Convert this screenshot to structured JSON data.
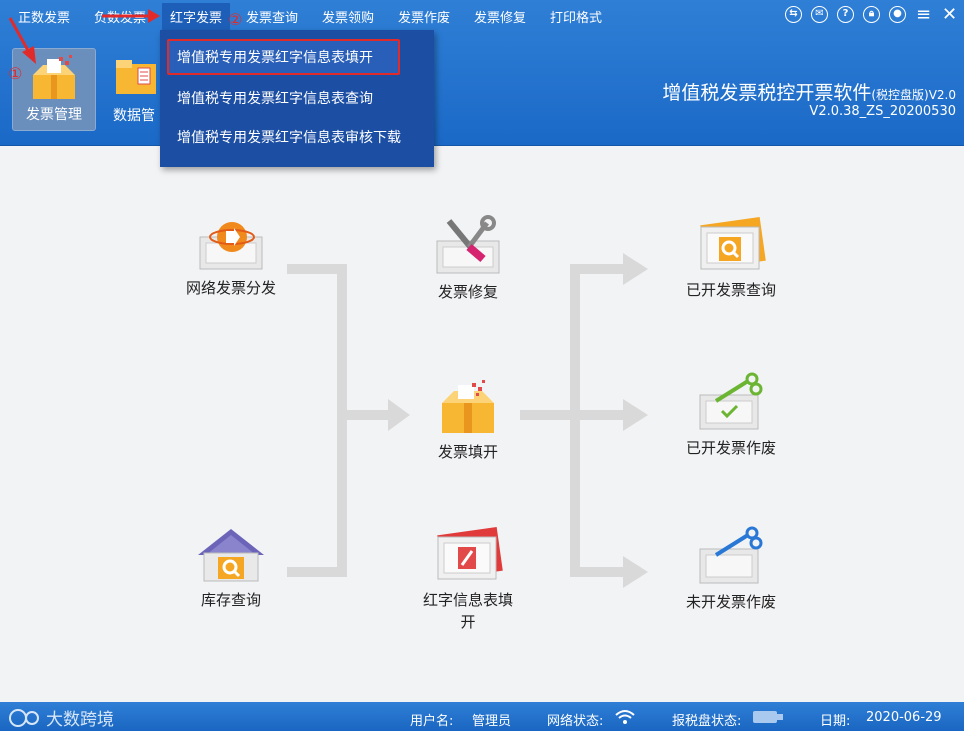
{
  "menu": {
    "items": [
      "正数发票",
      "负数发票",
      "红字发票",
      "发票查询",
      "发票领购",
      "发票作废",
      "发票修复",
      "打印格式"
    ],
    "active": "红字发票"
  },
  "window_controls": [
    "swap-icon",
    "chat-icon",
    "help-icon",
    "lock-icon",
    "user-icon",
    "menu-icon",
    "close-icon"
  ],
  "toolbar": {
    "invoice_manage": "发票管理",
    "data_manage": "数据管"
  },
  "app": {
    "title": "增值税发票税控开票软件",
    "edition": "(税控盘版)",
    "version_suffix": "V2.0",
    "build": "V2.0.38_ZS_20200530"
  },
  "dropdown": {
    "items": [
      "增值税专用发票红字信息表填开",
      "增值税专用发票红字信息表查询",
      "增值税专用发票红字信息表审核下载"
    ]
  },
  "annotations": {
    "step1": "①",
    "step2": "②"
  },
  "workflow": {
    "network_dist": "网络发票分发",
    "inventory": "库存查询",
    "repair": "发票修复",
    "fill": "发票填开",
    "red_fill": "红字信息表填开",
    "issued_query": "已开发票查询",
    "issued_void": "已开发票作废",
    "unissued_void": "未开发票作废"
  },
  "status": {
    "brand": "大数跨境",
    "user_label": "用户名:",
    "user_value": "管理员",
    "network_label": "网络状态:",
    "disk_label": "报税盘状态:",
    "date_label": "日期:",
    "date_value": "2020-06-29"
  },
  "colors": {
    "header": "#1b69c7",
    "dropdown": "#1c4fa4",
    "highlight": "#e12b2b",
    "flow_line": "#d8d8d8",
    "accent_orange": "#f5a623"
  }
}
